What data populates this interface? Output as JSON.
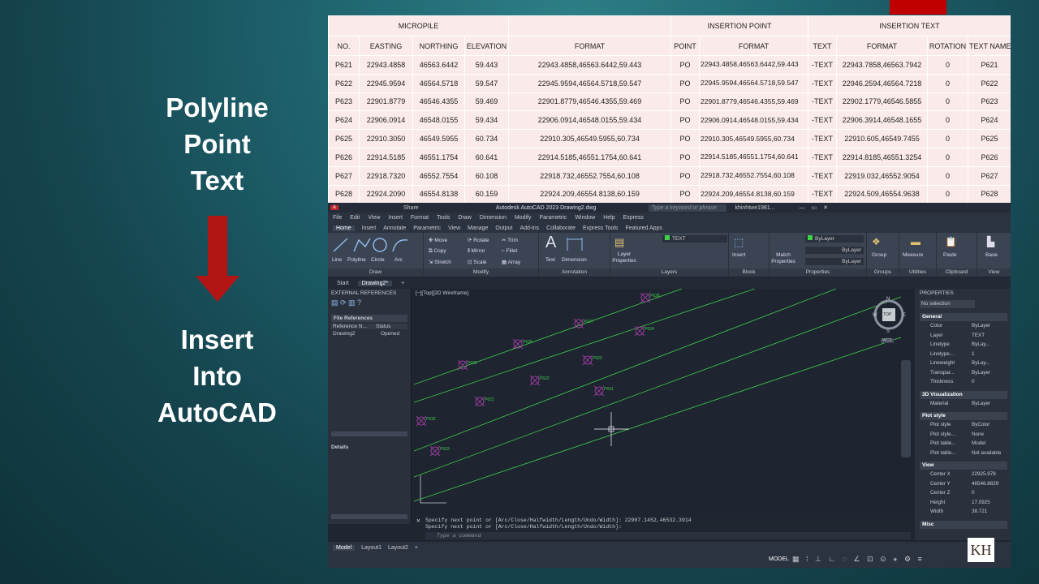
{
  "slide": {
    "title_top": [
      "Polyline",
      "Point",
      "Text"
    ],
    "title_bottom": [
      "Insert",
      "Into",
      "AutoCAD"
    ],
    "logo": "KH"
  },
  "table": {
    "groups": [
      "MICROPILE",
      "INSERTION POINT",
      "INSERTION TEXT"
    ],
    "headers": [
      "NO.",
      "EASTING",
      "NORTHING",
      "ELEVATION",
      "FORMAT",
      "POINT",
      "FORMAT",
      "TEXT",
      "FORMAT",
      "ROTATION",
      "TEXT NAME"
    ],
    "rows": [
      [
        "P621",
        "22943.4858",
        "46563.6442",
        "59.443",
        "22943.4858,46563.6442,59.443",
        "PO",
        "22943.4858,46563.6442,59.443",
        "-TEXT",
        "22943.7858,46563.7942",
        "0",
        "P621"
      ],
      [
        "P622",
        "22945.9594",
        "46564.5718",
        "59.547",
        "22945.9594,46564.5718,59.547",
        "PO",
        "22945.9594,46564.5718,59.547",
        "-TEXT",
        "22946.2594,46564.7218",
        "0",
        "P622"
      ],
      [
        "P623",
        "22901.8779",
        "46546.4355",
        "59.469",
        "22901.8779,46546.4355,59.469",
        "PO",
        "22901.8779,46546.4355,59.469",
        "-TEXT",
        "22902.1779,46546.5855",
        "0",
        "P623"
      ],
      [
        "P624",
        "22906.0914",
        "46548.0155",
        "59.434",
        "22906.0914,46548.0155,59.434",
        "PO",
        "22906.0914,46548.0155,59.434",
        "-TEXT",
        "22906.3914,46548.1655",
        "0",
        "P624"
      ],
      [
        "P625",
        "22910.3050",
        "46549.5955",
        "60.734",
        "22910.305,46549.5955,60.734",
        "PO",
        "22910.305,46549.5955,60.734",
        "-TEXT",
        "22910.605,46549.7455",
        "0",
        "P625"
      ],
      [
        "P626",
        "22914.5185",
        "46551.1754",
        "60.641",
        "22914.5185,46551.1754,60.641",
        "PO",
        "22914.5185,46551.1754,60.641",
        "-TEXT",
        "22914.8185,46551.3254",
        "0",
        "P626"
      ],
      [
        "P627",
        "22918.7320",
        "46552.7554",
        "60.108",
        "22918.732,46552.7554,60.108",
        "PO",
        "22918.732,46552.7554,60.108",
        "-TEXT",
        "22919.032,46552.9054",
        "0",
        "P627"
      ],
      [
        "P628",
        "22924.2090",
        "46554.8138",
        "60.159",
        "22924.209,46554.8138,60.159",
        "PO",
        "22924.209,46554.8138,60.159",
        "-TEXT",
        "22924.509,46554.9638",
        "0",
        "P628"
      ]
    ]
  },
  "cad": {
    "app_title": "Autodesk AutoCAD 2023    Drawing2.dwg",
    "search_placeholder": "Type a keyword or phrase",
    "user": "khinhtwe1981...",
    "share": "Share",
    "menus": [
      "File",
      "Edit",
      "View",
      "Insert",
      "Format",
      "Tools",
      "Draw",
      "Dimension",
      "Modify",
      "Parametric",
      "Window",
      "Help",
      "Express"
    ],
    "ribbon_tabs": [
      "Home",
      "Insert",
      "Annotate",
      "Parametric",
      "View",
      "Manage",
      "Output",
      "Add-ins",
      "Collaborate",
      "Express Tools",
      "Featured Apps"
    ],
    "draw_tools": [
      "Line",
      "Polyline",
      "Circle",
      "Arc"
    ],
    "modify_tools": [
      "Move",
      "Rotate",
      "Trim",
      "Copy",
      "Mirror",
      "Fillet",
      "Stretch",
      "Scale",
      "Array"
    ],
    "annotation_tools": [
      "Text",
      "Dimension"
    ],
    "layer_tool": "Layer Properties",
    "layer_name": "TEXT",
    "block_tool": "Insert",
    "match_tool": "Match Properties",
    "bylayer": "ByLayer",
    "group_tool": "Group",
    "measure_tool": "Measure",
    "paste_tool": "Paste",
    "base_tool": "Base",
    "panel_labels": [
      "Draw",
      "Modify",
      "Annotation",
      "Layers",
      "Block",
      "Properties",
      "Groups",
      "Utilities",
      "Clipboard",
      "View"
    ],
    "doc_tabs": [
      "Start",
      "Drawing2*"
    ],
    "viewport_label": "[−][Top][2D Wireframe]",
    "xref_title": "EXTERNAL REFERENCES",
    "file_refs": "File References",
    "ref_cols": [
      "Reference N...",
      "Status"
    ],
    "ref_row": [
      "Drawing2",
      "Opened"
    ],
    "details": "Details",
    "props_title": "PROPERTIES",
    "no_selection": "No selection",
    "sections": [
      "General",
      "3D Visualization",
      "Plot style",
      "View",
      "Misc"
    ],
    "general": [
      [
        "Color",
        "ByLayer"
      ],
      [
        "Layer",
        "TEXT"
      ],
      [
        "Linetype",
        "ByLay..."
      ],
      [
        "Linetype...",
        "1"
      ],
      [
        "Lineweight",
        "ByLay..."
      ],
      [
        "Transpar...",
        "ByLayer"
      ],
      [
        "Thickness",
        "0"
      ]
    ],
    "viz": [
      [
        "Material",
        "ByLayer"
      ]
    ],
    "plot": [
      [
        "Plot style",
        "ByColor"
      ],
      [
        "Plot style...",
        "None"
      ],
      [
        "Plot table...",
        "Model"
      ],
      [
        "Plot table...",
        "Not available"
      ]
    ],
    "view": [
      [
        "Center X",
        "22925.978"
      ],
      [
        "Center Y",
        "46546.8829"
      ],
      [
        "Center Z",
        "0"
      ],
      [
        "Height",
        "17.0925"
      ],
      [
        "Width",
        "38.721"
      ]
    ],
    "cmd_lines": [
      "Specify next point or [Arc/Close/Halfwidth/Length/Undo/Width]: 22907.1452,46532.3914",
      "Specify next point or [Arc/Close/Halfwidth/Length/Undo/Width]:"
    ],
    "cmd_placeholder": "Type a command",
    "layout_tabs": [
      "Model",
      "Layout1",
      "Layout2"
    ],
    "status_model": "MODEL",
    "compass": [
      "N",
      "S",
      "W",
      "E",
      "TOP",
      "WCS"
    ],
    "point_labels": [
      "P628",
      "P627",
      "P626",
      "P625",
      "P624",
      "P623",
      "P622",
      "P621",
      "P631",
      "P632",
      "P633",
      "P634",
      "P635"
    ]
  }
}
